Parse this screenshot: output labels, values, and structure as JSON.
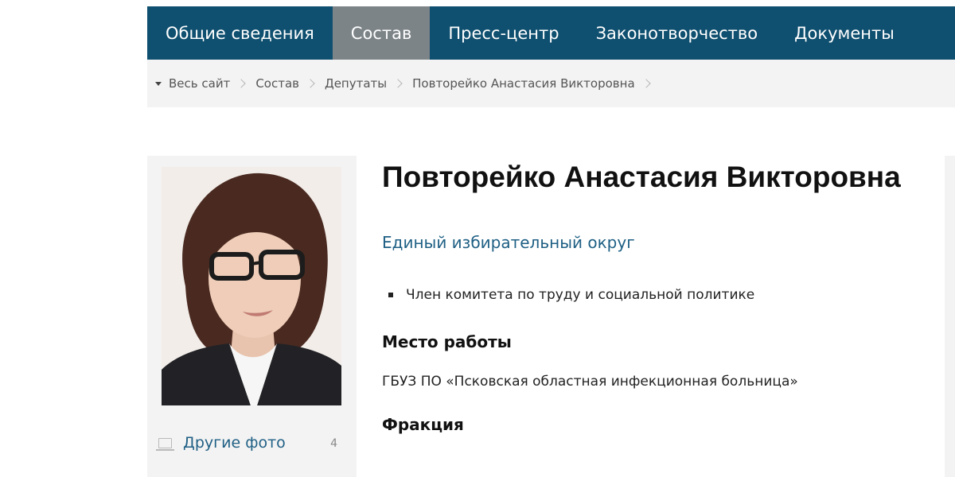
{
  "nav": {
    "items": [
      {
        "label": "Общие сведения",
        "active": false
      },
      {
        "label": "Состав",
        "active": true
      },
      {
        "label": "Пресс-центр",
        "active": false
      },
      {
        "label": "Законотворчество",
        "active": false
      },
      {
        "label": "Документы",
        "active": false
      }
    ]
  },
  "breadcrumb": {
    "items": [
      "Весь сайт",
      "Состав",
      "Депутаты",
      "Повторейко Анастасия Викторовна"
    ]
  },
  "sidebar": {
    "other_photos_label": "Другие фото",
    "photos_count": "4"
  },
  "profile": {
    "name": "Повторейко Анастасия Викторовна",
    "district": "Единый избирательный округ",
    "roles": [
      "Член комитета по труду и социальной политике"
    ],
    "work_heading": "Место работы",
    "work_place": "ГБУЗ ПО «Псковская областная инфекционная больница»",
    "faction_heading": "Фракция"
  },
  "colors": {
    "nav_bg": "#0f4f6f",
    "nav_active_bg": "#7d8488",
    "link": "#1e5f84",
    "panel_bg": "#f3f3f3"
  }
}
